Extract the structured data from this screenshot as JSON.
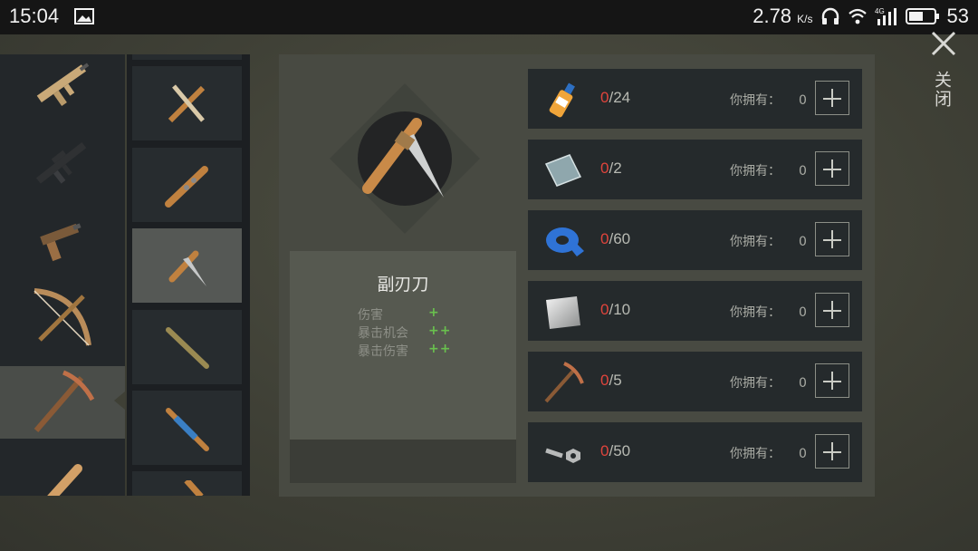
{
  "status_bar": {
    "time": "15:04",
    "net_speed": "2.78",
    "net_unit": "K/s",
    "network_badge": "4G",
    "battery": "53"
  },
  "categories": [
    {
      "icon": "assault-rifle-icon"
    },
    {
      "icon": "m16-rifle-icon"
    },
    {
      "icon": "pistol-icon"
    },
    {
      "icon": "crossbow-icon"
    },
    {
      "icon": "pickaxe-icon",
      "active": true
    },
    {
      "icon": "baseball-bat-icon"
    }
  ],
  "items": [
    {
      "icon": "crossed-bone-knives-icon"
    },
    {
      "icon": "spiked-club-icon"
    },
    {
      "icon": "dagger-icon",
      "selected": true
    },
    {
      "icon": "wooden-spear-icon"
    },
    {
      "icon": "taped-spear-icon"
    },
    {
      "icon": "club-partial-icon"
    }
  ],
  "selected_item": {
    "name": "副刃刀",
    "stats": [
      {
        "label": "伤害",
        "value": "+"
      },
      {
        "label": "暴击机会",
        "value": "++"
      },
      {
        "label": "暴击伤害",
        "value": "++"
      }
    ]
  },
  "materials": [
    {
      "icon": "glue-bottle-icon",
      "current": "0",
      "required": "/24",
      "have_label": "你拥有：",
      "have": "0"
    },
    {
      "icon": "metal-plate-icon",
      "current": "0",
      "required": "/2",
      "have_label": "你拥有：",
      "have": "0"
    },
    {
      "icon": "duct-tape-icon",
      "current": "0",
      "required": "/60",
      "have_label": "你拥有：",
      "have": "0"
    },
    {
      "icon": "sheet-metal-icon",
      "current": "0",
      "required": "/10",
      "have_label": "你拥有：",
      "have": "0"
    },
    {
      "icon": "pickaxe-material-icon",
      "current": "0",
      "required": "/5",
      "have_label": "你拥有：",
      "have": "0"
    },
    {
      "icon": "nuts-bolts-icon",
      "current": "0",
      "required": "/50",
      "have_label": "你拥有：",
      "have": "0"
    }
  ],
  "close_label": "关闭",
  "colors": {
    "required_red": "#e0443c",
    "bonus_green": "#69c04e"
  }
}
